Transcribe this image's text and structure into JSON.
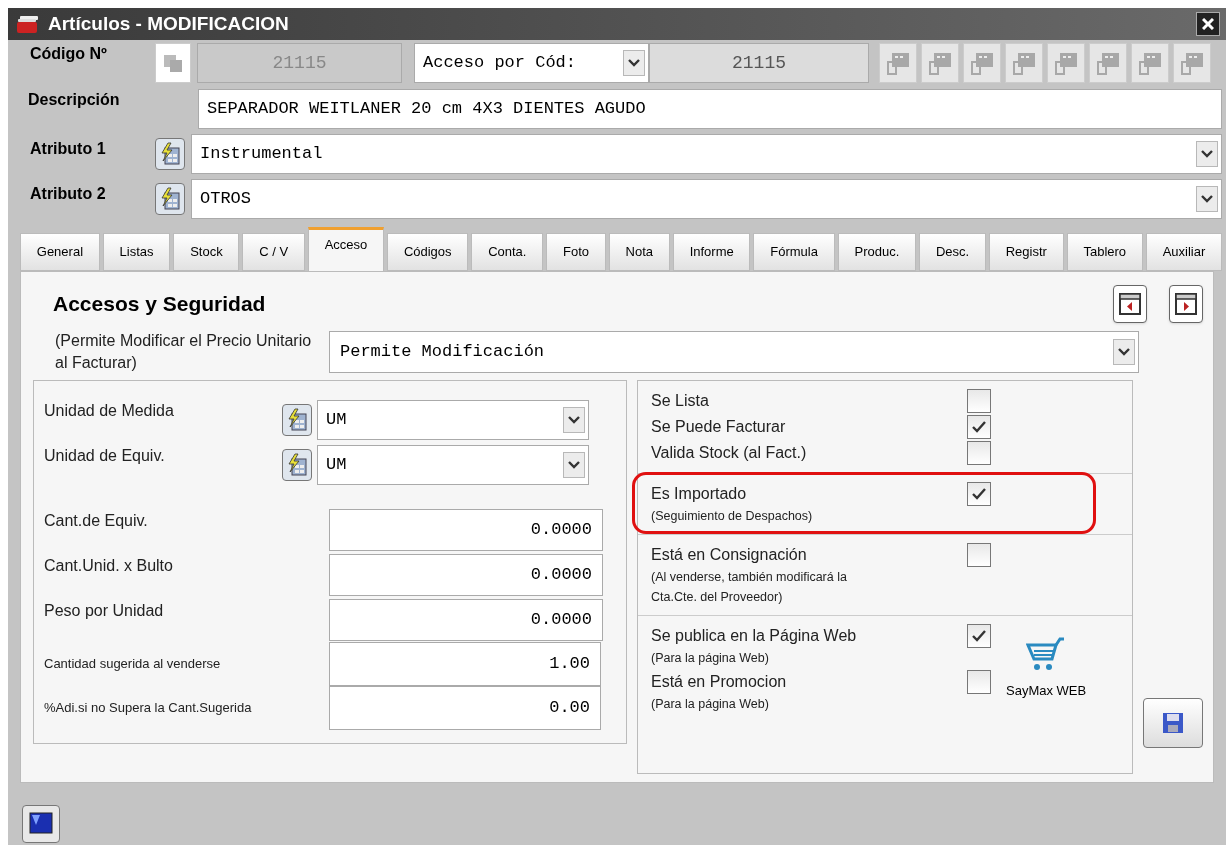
{
  "window": {
    "title": "Artículos - MODIFICACION"
  },
  "header": {
    "code_label": "Código Nº",
    "code_value": "21115",
    "lookup_mode": "Acceso por Cód:",
    "lookup_value": "21115",
    "toolbar": [
      {
        "disabled": true
      },
      {
        "disabled": true
      },
      {
        "disabled": true
      },
      {
        "disabled": true
      },
      {
        "disabled": true
      },
      {
        "disabled": true
      },
      {
        "disabled": true
      },
      {
        "disabled": true
      }
    ],
    "description_label": "Descripción",
    "description": "SEPARADOR WEITLANER 20 cm 4X3 DIENTES AGUDO",
    "attributes": [
      {
        "label": "Atributo 1",
        "value": "Instrumental"
      },
      {
        "label": "Atributo 2",
        "value": "OTROS"
      }
    ]
  },
  "tabs": [
    {
      "label": "General",
      "selected": false
    },
    {
      "label": "Listas",
      "selected": false
    },
    {
      "label": "Stock",
      "selected": false
    },
    {
      "label": "C / V",
      "selected": false
    },
    {
      "label": "Acceso",
      "selected": true
    },
    {
      "label": "Códigos",
      "selected": false
    },
    {
      "label": "Conta.",
      "selected": false
    },
    {
      "label": "Foto",
      "selected": false
    },
    {
      "label": "Nota",
      "selected": false
    },
    {
      "label": "Informe",
      "selected": false
    },
    {
      "label": "Fórmula",
      "selected": false
    },
    {
      "label": "Produc.",
      "selected": false
    },
    {
      "label": "Desc.",
      "selected": false
    },
    {
      "label": "Registr",
      "selected": false
    },
    {
      "label": "Tablero",
      "selected": false
    },
    {
      "label": "Auxiliar",
      "selected": false
    }
  ],
  "panel": {
    "title": "Accesos y Seguridad",
    "price_label": "(Permite Modificar el Precio Unitario al Facturar)",
    "price_value": "Permite Modificación",
    "units": [
      {
        "label": "Unidad de Medida",
        "value": "UM"
      },
      {
        "label": "Unidad de Equiv.",
        "value": "UM"
      }
    ],
    "quantities": [
      {
        "label": "Cant.de Equiv.",
        "value": "0.0000"
      },
      {
        "label": "Cant.Unid. x Bulto",
        "value": "0.0000"
      },
      {
        "label": "Peso por Unidad",
        "value": "0.0000"
      }
    ],
    "suggested": [
      {
        "label": "Cantidad sugerida al venderse",
        "value": "1.00"
      },
      {
        "label": "%Adi.si no Supera la Cant.Sugerida",
        "value": "0.00"
      }
    ],
    "sections": [
      {
        "highlighted": false,
        "items": [
          {
            "label": "Se Lista",
            "checked": false
          },
          {
            "label": "Se Puede Facturar",
            "checked": true
          },
          {
            "label": "Valida Stock (al Fact.)",
            "checked": false
          }
        ]
      },
      {
        "highlighted": true,
        "items": [
          {
            "label": "Es Importado",
            "note": "(Seguimiento de Despachos)",
            "checked": true
          }
        ]
      },
      {
        "highlighted": false,
        "items": [
          {
            "label": "Está en Consignación",
            "note": "(Al venderse, también modificará la Cta.Cte. del Proveedor)",
            "checked": false
          }
        ]
      },
      {
        "highlighted": false,
        "web_label": "SayMax WEB",
        "items": [
          {
            "label": "Se publica en la Página Web",
            "note": "(Para la página Web)",
            "checked": true
          },
          {
            "label": "Está en Promocion",
            "note": "(Para la página Web)",
            "checked": false
          }
        ]
      }
    ]
  }
}
